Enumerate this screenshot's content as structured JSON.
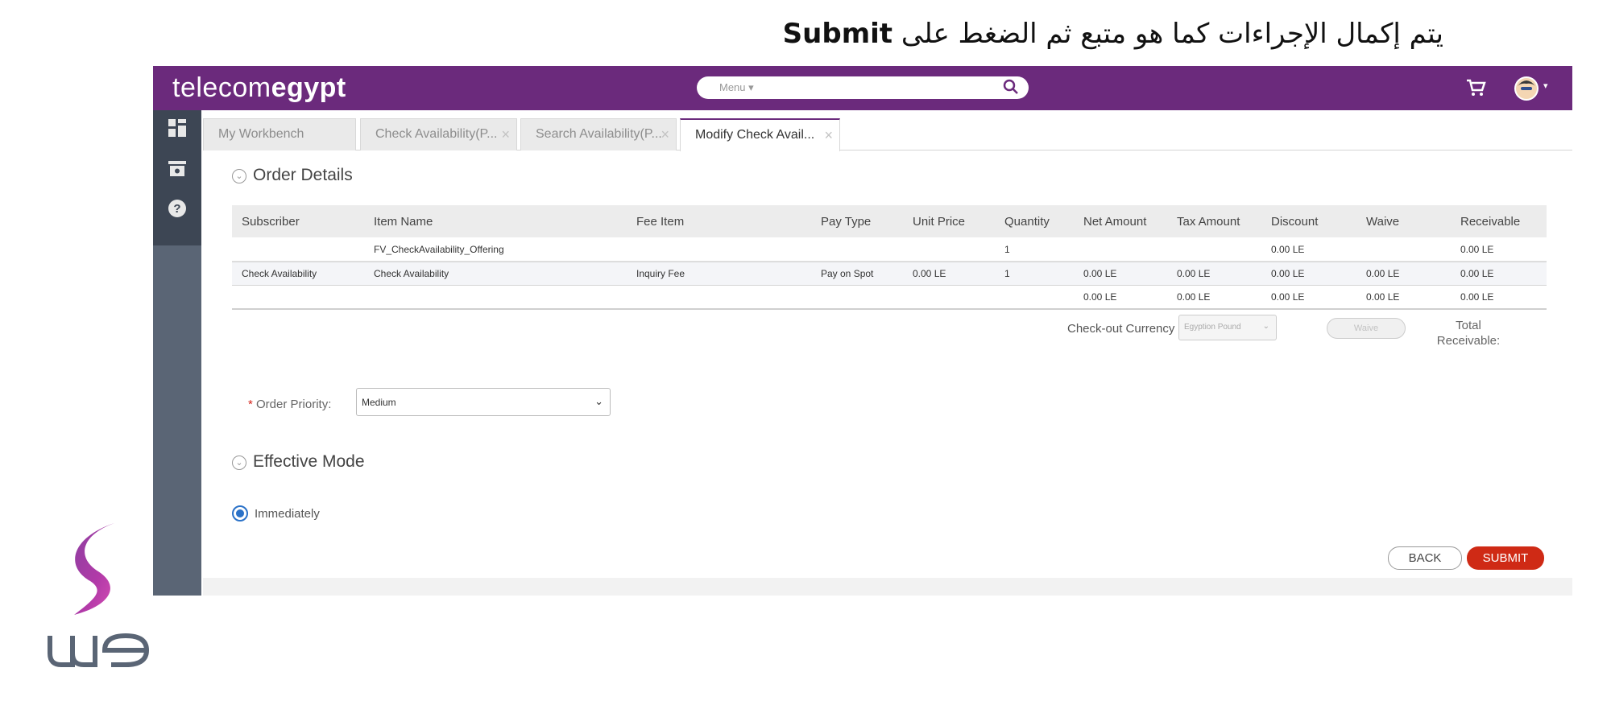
{
  "instruction": {
    "text_ar": "يتم إكمال الإجراءات كما هو متبع ثم الضغط على",
    "text_en": "Submit"
  },
  "header": {
    "logo_light": "telecom",
    "logo_bold": "egypt",
    "menu_label": "Menu ▾"
  },
  "tabs": [
    {
      "label": "My Workbench"
    },
    {
      "label": "Check Availability(P..."
    },
    {
      "label": "Search Availability(P..."
    },
    {
      "label": "Modify Check Avail..."
    }
  ],
  "order_details": {
    "title": "Order Details",
    "columns": [
      "Subscriber",
      "Item Name",
      "Fee Item",
      "Pay Type",
      "Unit Price",
      "Quantity",
      "Net Amount",
      "Tax Amount",
      "Discount",
      "Waive",
      "Receivable"
    ],
    "rows": [
      [
        "",
        "FV_CheckAvailability_Offering",
        "",
        "",
        "",
        "1",
        "",
        "",
        "0.00 LE",
        "",
        "0.00 LE"
      ],
      [
        "Check Availability",
        "Check Availability",
        "Inquiry Fee",
        "Pay on Spot",
        "0.00 LE",
        "1",
        "0.00 LE",
        "0.00 LE",
        "0.00 LE",
        "0.00 LE",
        "0.00 LE"
      ],
      [
        "",
        "",
        "",
        "",
        "",
        "",
        "0.00 LE",
        "0.00 LE",
        "0.00 LE",
        "0.00 LE",
        "0.00 LE"
      ]
    ],
    "checkout_currency_label": "Check-out Currency :",
    "checkout_currency_value": "Egyption Pound",
    "waive_label": "Waive",
    "total_receivable_line1": "Total",
    "total_receivable_line2": "Receivable:"
  },
  "order_priority": {
    "label": "Order Priority:",
    "required_mark": "*",
    "value": "Medium"
  },
  "effective_mode": {
    "title": "Effective Mode",
    "option": "Immediately"
  },
  "actions": {
    "back": "BACK",
    "submit": "SUBMIT"
  },
  "colors": {
    "brand_purple": "#6b2a7c",
    "submit_red": "#cf2a15",
    "radio_blue": "#2b72c8"
  }
}
